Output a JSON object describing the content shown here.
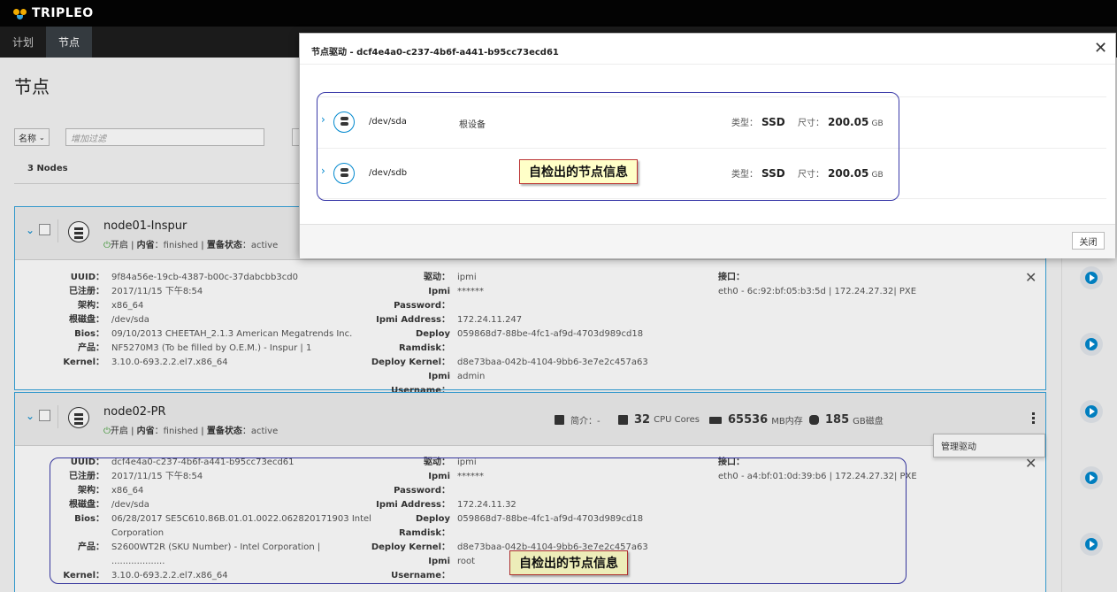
{
  "brand": {
    "name": "TRIPLEO"
  },
  "nav": {
    "tabs": [
      "计划",
      "节点"
    ]
  },
  "page": {
    "title": "节点",
    "filter_select": "名称",
    "filter_placeholder": "增加过滤",
    "count_label": "3 Nodes"
  },
  "nodes": [
    {
      "name": "node01-Inspur",
      "status": {
        "power": "开启",
        "inspect_label": "内省",
        "inspect_value": "finished",
        "provision_label": "置备状态",
        "provision_value": "active"
      },
      "left": [
        [
          "UUID",
          "9f84a56e-19cb-4387-b00c-37dabcbb3cd0"
        ],
        [
          "已注册",
          "2017/11/15 下午8:54"
        ],
        [
          "架构",
          "x86_64"
        ],
        [
          "根磁盘",
          "/dev/sda"
        ],
        [
          "Bios",
          "09/10/2013 CHEETAH_2.1.3 American Megatrends Inc."
        ],
        [
          "产品",
          "NF5270M3 (To be filled by O.E.M.) - Inspur | 1"
        ],
        [
          "Kernel",
          "3.10.0-693.2.2.el7.x86_64"
        ]
      ],
      "mid": [
        [
          "驱动",
          "ipmi"
        ],
        [
          "Ipmi Password",
          "******"
        ],
        [
          "Ipmi Address",
          "172.24.11.247"
        ],
        [
          "Deploy Ramdisk",
          "059868d7-88be-4fc1-af9d-4703d989cd18"
        ],
        [
          "Deploy Kernel",
          "d8e73baa-042b-4104-9bb6-3e7e2c457a63"
        ],
        [
          "Ipmi Username",
          "admin"
        ]
      ],
      "iface_label": "接口",
      "iface_value": "eth0 - 6c:92:bf:05:b3:5d | 172.24.27.32| PXE"
    },
    {
      "name": "node02-PR",
      "status": {
        "power": "开启",
        "inspect_label": "内省",
        "inspect_value": "finished",
        "provision_label": "置备状态",
        "provision_value": "active"
      },
      "summary": {
        "profile_label": "简介：-",
        "cpu_value": "32",
        "cpu_unit": "CPU Cores",
        "mem_value": "65536",
        "mem_unit": "MB内存",
        "disk_value": "185",
        "disk_unit": "GB磁盘"
      },
      "left": [
        [
          "UUID",
          "dcf4e4a0-c237-4b6f-a441-b95cc73ecd61"
        ],
        [
          "已注册",
          "2017/11/15 下午8:54"
        ],
        [
          "架构",
          "x86_64"
        ],
        [
          "根磁盘",
          "/dev/sda"
        ],
        [
          "Bios",
          "06/28/2017 SE5C610.86B.01.01.0022.062820171903 Intel"
        ],
        [
          "",
          "Corporation"
        ],
        [
          "产品",
          "S2600WT2R (SKU Number) - Intel Corporation |"
        ],
        [
          "",
          "..................."
        ],
        [
          "Kernel",
          "3.10.0-693.2.2.el7.x86_64"
        ]
      ],
      "mid": [
        [
          "驱动",
          "ipmi"
        ],
        [
          "Ipmi Password",
          "******"
        ],
        [
          "Ipmi Address",
          "172.24.11.32"
        ],
        [
          "Deploy Ramdisk",
          "059868d7-88be-4fc1-af9d-4703d989cd18"
        ],
        [
          "Deploy Kernel",
          "d8e73baa-042b-4104-9bb6-3e7e2c457a63"
        ],
        [
          "Ipmi Username",
          "root"
        ]
      ],
      "iface_label": "接口",
      "iface_value": "eth0 - a4:bf:01:0d:39:b6 | 172.24.27.32| PXE"
    }
  ],
  "dropdown": {
    "item": "管理驱动"
  },
  "modal": {
    "title": "节点驱动 - dcf4e4a0-c237-4b6f-a441-b95cc73ecd61",
    "close_button": "关闭",
    "disks": [
      {
        "name": "/dev/sda",
        "root": "根设备",
        "type_label": "类型：",
        "type_value": "SSD",
        "size_label": "尺寸：",
        "size_value": "200.05",
        "size_unit": "GB"
      },
      {
        "name": "/dev/sdb",
        "root": "",
        "type_label": "类型：",
        "type_value": "SSD",
        "size_label": "尺寸：",
        "size_value": "200.05",
        "size_unit": "GB"
      }
    ]
  },
  "annotations": [
    "自检出的节点信息",
    "自检出的节点信息"
  ],
  "colors": {
    "accent": "#0088ce",
    "power_on": "#3f9c35",
    "annotation_border": "#3a3aa8",
    "annotation_bg": "#ffffc8"
  }
}
